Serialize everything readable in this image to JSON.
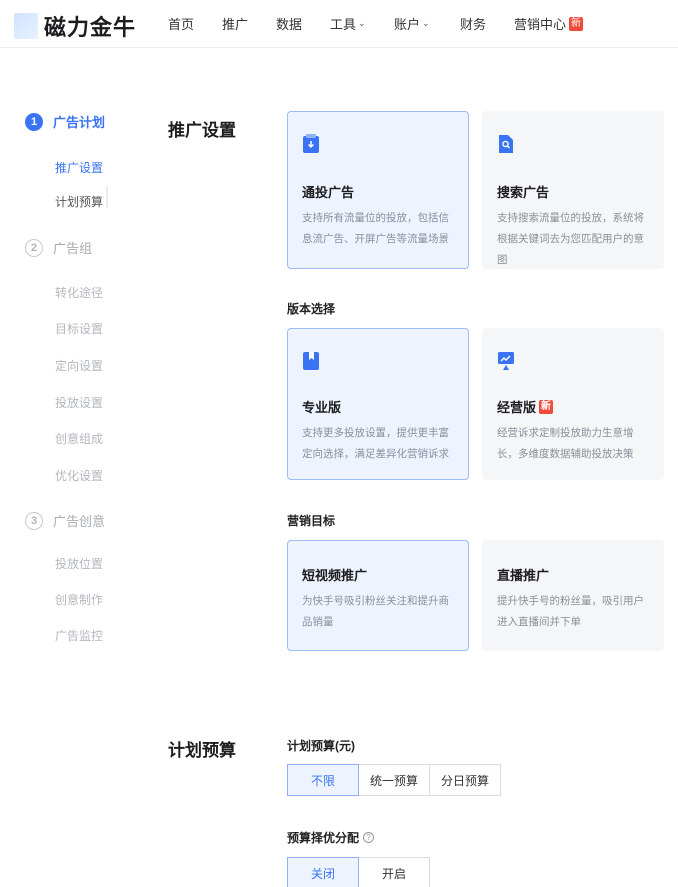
{
  "logo": {
    "text": "磁力金牛"
  },
  "nav": {
    "items": [
      {
        "label": "首页",
        "dropdown": false,
        "badge": ""
      },
      {
        "label": "推广",
        "dropdown": false,
        "badge": ""
      },
      {
        "label": "数据",
        "dropdown": false,
        "badge": ""
      },
      {
        "label": "工具",
        "dropdown": true,
        "badge": ""
      },
      {
        "label": "账户",
        "dropdown": true,
        "badge": ""
      },
      {
        "label": "财务",
        "dropdown": false,
        "badge": ""
      },
      {
        "label": "营销中心",
        "dropdown": false,
        "badge": "新"
      }
    ]
  },
  "sidebar": {
    "steps": [
      {
        "number": "1",
        "label": "广告计划",
        "active": true,
        "subs": [
          "推广设置",
          "计划预算"
        ]
      },
      {
        "number": "2",
        "label": "广告组",
        "active": false,
        "subs": [
          "转化途径",
          "目标设置",
          "定向设置",
          "投放设置",
          "创意组成",
          "优化设置"
        ]
      },
      {
        "number": "3",
        "label": "广告创意",
        "active": false,
        "subs": [
          "投放位置",
          "创意制作",
          "广告监控"
        ]
      }
    ]
  },
  "promo": {
    "title": "推广设置",
    "ad_types": [
      {
        "title": "通投广告",
        "desc": "支持所有流量位的投放，包括信息流广告、开屏广告等流量场景",
        "selected": true,
        "icon": "download-doc-icon"
      },
      {
        "title": "搜索广告",
        "desc": "支持搜索流量位的投放，系统将根据关键词去为您匹配用户的意图",
        "selected": false,
        "icon": "search-doc-icon"
      }
    ],
    "version_label": "版本选择",
    "versions": [
      {
        "title": "专业版",
        "desc": "支持更多投放设置，提供更丰富定向选择，满足差异化营销诉求",
        "selected": true,
        "badge": "",
        "icon": "bookmark-icon"
      },
      {
        "title": "经营版",
        "desc": "经营诉求定制投放助力生意增长，多维度数据辅助投放决策",
        "selected": false,
        "badge": "新",
        "icon": "chart-monitor-icon"
      }
    ],
    "goal_label": "营销目标",
    "goals": [
      {
        "title": "短视频推广",
        "desc": "为快手号吸引粉丝关注和提升商品销量",
        "selected": true
      },
      {
        "title": "直播推广",
        "desc": "提升快手号的粉丝量，吸引用户进入直播间并下单",
        "selected": false
      }
    ]
  },
  "budget": {
    "title": "计划预算",
    "budget_label": "计划预算(元)",
    "budget_options": [
      "不限",
      "统一预算",
      "分日预算"
    ],
    "budget_selected": 0,
    "alloc_label": "预算择优分配",
    "alloc_options": [
      "关闭",
      "开启"
    ],
    "alloc_selected": 0
  },
  "colors": {
    "accent": "#3a73f3",
    "badge": "#f04a3a",
    "selected_bg": "#eef4ff"
  }
}
